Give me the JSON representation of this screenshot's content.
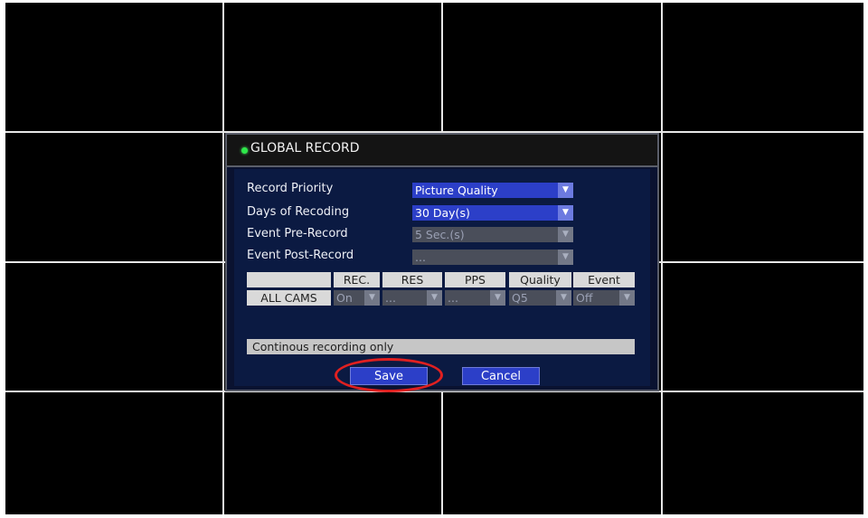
{
  "dialog": {
    "title": "GLOBAL RECORD",
    "fields": {
      "record_priority": {
        "label": "Record Priority",
        "value": "Picture Quality"
      },
      "days_of_recording": {
        "label": "Days of Recoding",
        "value": "30 Day(s)"
      },
      "event_pre_record": {
        "label": "Event Pre-Record",
        "value": "5 Sec.(s)"
      },
      "event_post_record": {
        "label": "Event Post-Record",
        "value": "..."
      }
    },
    "table": {
      "headers": {
        "rec": "REC.",
        "res": "RES",
        "pps": "PPS",
        "quality": "Quality",
        "event": "Event"
      },
      "row": {
        "camera": "ALL CAMS",
        "rec": "On",
        "res": "...",
        "pps": "...",
        "quality": "Q5",
        "event": "Off"
      }
    },
    "info_text": "Continous recording only",
    "buttons": {
      "save": "Save",
      "cancel": "Cancel"
    }
  },
  "colors": {
    "dialog_bg": "#0b1a42",
    "active_select": "#2c3fc8",
    "disabled_select": "#4a4e5a",
    "status_dot": "#2ee84a",
    "highlight": "#e02020"
  },
  "icons": {
    "dropdown": "chevron-down-icon",
    "status": "status-dot-icon"
  }
}
